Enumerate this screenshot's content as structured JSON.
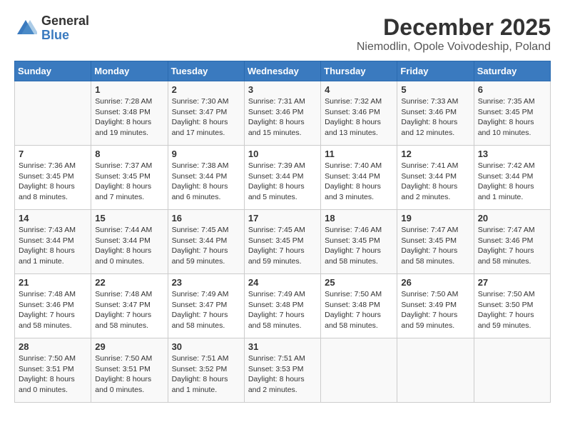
{
  "header": {
    "logo_general": "General",
    "logo_blue": "Blue",
    "title": "December 2025",
    "location": "Niemodlin, Opole Voivodeship, Poland"
  },
  "columns": [
    "Sunday",
    "Monday",
    "Tuesday",
    "Wednesday",
    "Thursday",
    "Friday",
    "Saturday"
  ],
  "weeks": [
    [
      {
        "day": "",
        "info": ""
      },
      {
        "day": "1",
        "info": "Sunrise: 7:28 AM\nSunset: 3:48 PM\nDaylight: 8 hours\nand 19 minutes."
      },
      {
        "day": "2",
        "info": "Sunrise: 7:30 AM\nSunset: 3:47 PM\nDaylight: 8 hours\nand 17 minutes."
      },
      {
        "day": "3",
        "info": "Sunrise: 7:31 AM\nSunset: 3:46 PM\nDaylight: 8 hours\nand 15 minutes."
      },
      {
        "day": "4",
        "info": "Sunrise: 7:32 AM\nSunset: 3:46 PM\nDaylight: 8 hours\nand 13 minutes."
      },
      {
        "day": "5",
        "info": "Sunrise: 7:33 AM\nSunset: 3:46 PM\nDaylight: 8 hours\nand 12 minutes."
      },
      {
        "day": "6",
        "info": "Sunrise: 7:35 AM\nSunset: 3:45 PM\nDaylight: 8 hours\nand 10 minutes."
      }
    ],
    [
      {
        "day": "7",
        "info": "Sunrise: 7:36 AM\nSunset: 3:45 PM\nDaylight: 8 hours\nand 8 minutes."
      },
      {
        "day": "8",
        "info": "Sunrise: 7:37 AM\nSunset: 3:45 PM\nDaylight: 8 hours\nand 7 minutes."
      },
      {
        "day": "9",
        "info": "Sunrise: 7:38 AM\nSunset: 3:44 PM\nDaylight: 8 hours\nand 6 minutes."
      },
      {
        "day": "10",
        "info": "Sunrise: 7:39 AM\nSunset: 3:44 PM\nDaylight: 8 hours\nand 5 minutes."
      },
      {
        "day": "11",
        "info": "Sunrise: 7:40 AM\nSunset: 3:44 PM\nDaylight: 8 hours\nand 3 minutes."
      },
      {
        "day": "12",
        "info": "Sunrise: 7:41 AM\nSunset: 3:44 PM\nDaylight: 8 hours\nand 2 minutes."
      },
      {
        "day": "13",
        "info": "Sunrise: 7:42 AM\nSunset: 3:44 PM\nDaylight: 8 hours\nand 1 minute."
      }
    ],
    [
      {
        "day": "14",
        "info": "Sunrise: 7:43 AM\nSunset: 3:44 PM\nDaylight: 8 hours\nand 1 minute."
      },
      {
        "day": "15",
        "info": "Sunrise: 7:44 AM\nSunset: 3:44 PM\nDaylight: 8 hours\nand 0 minutes."
      },
      {
        "day": "16",
        "info": "Sunrise: 7:45 AM\nSunset: 3:44 PM\nDaylight: 7 hours\nand 59 minutes."
      },
      {
        "day": "17",
        "info": "Sunrise: 7:45 AM\nSunset: 3:45 PM\nDaylight: 7 hours\nand 59 minutes."
      },
      {
        "day": "18",
        "info": "Sunrise: 7:46 AM\nSunset: 3:45 PM\nDaylight: 7 hours\nand 58 minutes."
      },
      {
        "day": "19",
        "info": "Sunrise: 7:47 AM\nSunset: 3:45 PM\nDaylight: 7 hours\nand 58 minutes."
      },
      {
        "day": "20",
        "info": "Sunrise: 7:47 AM\nSunset: 3:46 PM\nDaylight: 7 hours\nand 58 minutes."
      }
    ],
    [
      {
        "day": "21",
        "info": "Sunrise: 7:48 AM\nSunset: 3:46 PM\nDaylight: 7 hours\nand 58 minutes."
      },
      {
        "day": "22",
        "info": "Sunrise: 7:48 AM\nSunset: 3:47 PM\nDaylight: 7 hours\nand 58 minutes."
      },
      {
        "day": "23",
        "info": "Sunrise: 7:49 AM\nSunset: 3:47 PM\nDaylight: 7 hours\nand 58 minutes."
      },
      {
        "day": "24",
        "info": "Sunrise: 7:49 AM\nSunset: 3:48 PM\nDaylight: 7 hours\nand 58 minutes."
      },
      {
        "day": "25",
        "info": "Sunrise: 7:50 AM\nSunset: 3:48 PM\nDaylight: 7 hours\nand 58 minutes."
      },
      {
        "day": "26",
        "info": "Sunrise: 7:50 AM\nSunset: 3:49 PM\nDaylight: 7 hours\nand 59 minutes."
      },
      {
        "day": "27",
        "info": "Sunrise: 7:50 AM\nSunset: 3:50 PM\nDaylight: 7 hours\nand 59 minutes."
      }
    ],
    [
      {
        "day": "28",
        "info": "Sunrise: 7:50 AM\nSunset: 3:51 PM\nDaylight: 8 hours\nand 0 minutes."
      },
      {
        "day": "29",
        "info": "Sunrise: 7:50 AM\nSunset: 3:51 PM\nDaylight: 8 hours\nand 0 minutes."
      },
      {
        "day": "30",
        "info": "Sunrise: 7:51 AM\nSunset: 3:52 PM\nDaylight: 8 hours\nand 1 minute."
      },
      {
        "day": "31",
        "info": "Sunrise: 7:51 AM\nSunset: 3:53 PM\nDaylight: 8 hours\nand 2 minutes."
      },
      {
        "day": "",
        "info": ""
      },
      {
        "day": "",
        "info": ""
      },
      {
        "day": "",
        "info": ""
      }
    ]
  ]
}
